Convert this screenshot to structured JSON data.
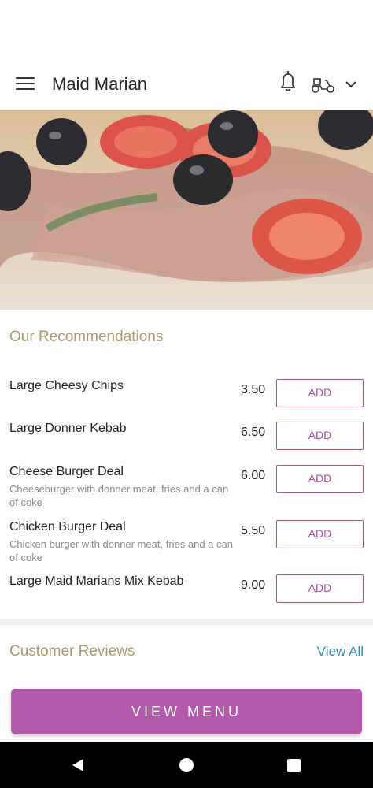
{
  "header": {
    "title": "Maid Marian"
  },
  "recommendations": {
    "title": "Our Recommendations",
    "items": [
      {
        "name": "Large Cheesy Chips",
        "description": "",
        "price": "3.50",
        "add_label": "ADD"
      },
      {
        "name": "Large Donner Kebab",
        "description": "",
        "price": "6.50",
        "add_label": "ADD"
      },
      {
        "name": "Cheese Burger Deal",
        "description": "Cheeseburger with donner meat, fries and a can of coke",
        "price": "6.00",
        "add_label": "ADD"
      },
      {
        "name": "Chicken Burger Deal",
        "description": "Chicken burger with donner meat, fries and a can of coke",
        "price": "5.50",
        "add_label": "ADD"
      },
      {
        "name": "Large Maid Marians Mix Kebab",
        "description": "",
        "price": "9.00",
        "add_label": "ADD"
      }
    ]
  },
  "reviews": {
    "title": "Customer Reviews",
    "view_all": "View All"
  },
  "cta": {
    "label": "VIEW MENU"
  },
  "colors": {
    "accent": "#b35aad",
    "section_title": "#a79a6e",
    "link": "#3a8fb0"
  },
  "icons": [
    "menu-icon",
    "bell-icon",
    "scooter-icon",
    "chevron-down-icon",
    "back-icon",
    "home-icon",
    "recents-icon"
  ]
}
